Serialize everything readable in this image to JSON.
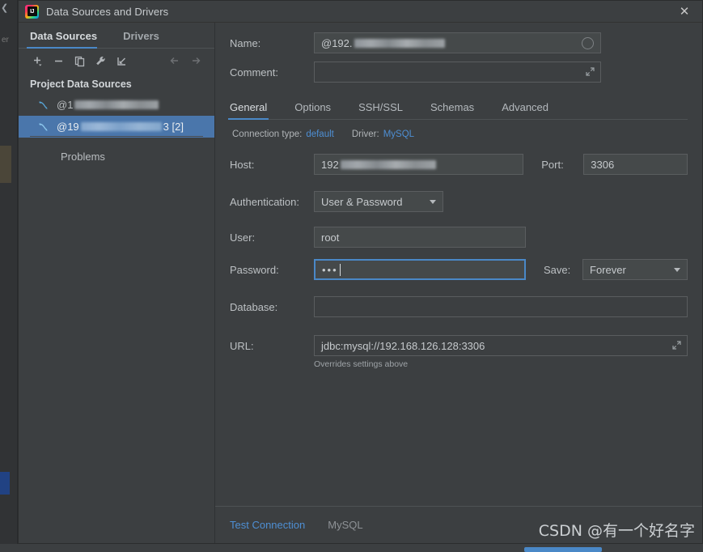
{
  "window": {
    "title": "Data Sources and Drivers",
    "app_icon": "intellij-idea-icon",
    "close_label": "✕"
  },
  "sidebar": {
    "tabs": [
      {
        "label": "Data Sources",
        "active": true
      },
      {
        "label": "Drivers",
        "active": false
      }
    ],
    "toolbar": [
      {
        "name": "add-icon",
        "glyph": "+"
      },
      {
        "name": "remove-icon",
        "glyph": "−"
      },
      {
        "name": "duplicate-icon",
        "glyph": "❐"
      },
      {
        "name": "properties-wrench-icon",
        "glyph": "🔧"
      },
      {
        "name": "import-icon",
        "glyph": "↙"
      },
      {
        "name": "navigate-back-icon",
        "glyph": "←"
      },
      {
        "name": "navigate-forward-icon",
        "glyph": "→"
      }
    ],
    "group_label": "Project Data Sources",
    "items": [
      {
        "name": "data-source-1",
        "prefix": "@1",
        "redacted": true,
        "suffix": "",
        "selected": false
      },
      {
        "name": "data-source-2",
        "prefix": "@19",
        "redacted": true,
        "suffix": "3 [2]",
        "selected": true
      }
    ],
    "problems_label": "Problems"
  },
  "main": {
    "name_label": "Name:",
    "name_value": "@192.",
    "name_redacted": true,
    "name_color_indicator": "circle-icon",
    "comment_label": "Comment:",
    "comment_value": "",
    "comment_expand_icon": "expand-icon",
    "tabs": [
      {
        "label": "General",
        "active": true
      },
      {
        "label": "Options",
        "active": false
      },
      {
        "label": "SSH/SSL",
        "active": false
      },
      {
        "label": "Schemas",
        "active": false
      },
      {
        "label": "Advanced",
        "active": false
      }
    ],
    "connection_type_label": "Connection type:",
    "connection_type_value": "default",
    "driver_label": "Driver:",
    "driver_value": "MySQL",
    "host_label": "Host:",
    "host_value": "192",
    "host_redacted": true,
    "port_label": "Port:",
    "port_value": "3306",
    "auth_label": "Authentication:",
    "auth_value": "User & Password",
    "user_label": "User:",
    "user_value": "root",
    "password_label": "Password:",
    "password_value": "•••",
    "password_focused": true,
    "save_label": "Save:",
    "save_value": "Forever",
    "database_label": "Database:",
    "database_value": "",
    "url_label": "URL:",
    "url_value": "jdbc:mysql://192.168.126.128:3306",
    "url_note": "Overrides settings above",
    "url_expand_icon": "expand-icon"
  },
  "bottom": {
    "test_connection_label": "Test Connection",
    "driver_status_label": "MySQL"
  },
  "watermark": {
    "text": "CSDN @有一个好名字"
  },
  "colors": {
    "accent_blue": "#4a88c7",
    "link_blue": "#4e8fd4",
    "selection_blue": "#4a76ab",
    "panel_bg": "#3c3f41",
    "input_bg": "#45494a",
    "text": "#bcc0c3"
  }
}
